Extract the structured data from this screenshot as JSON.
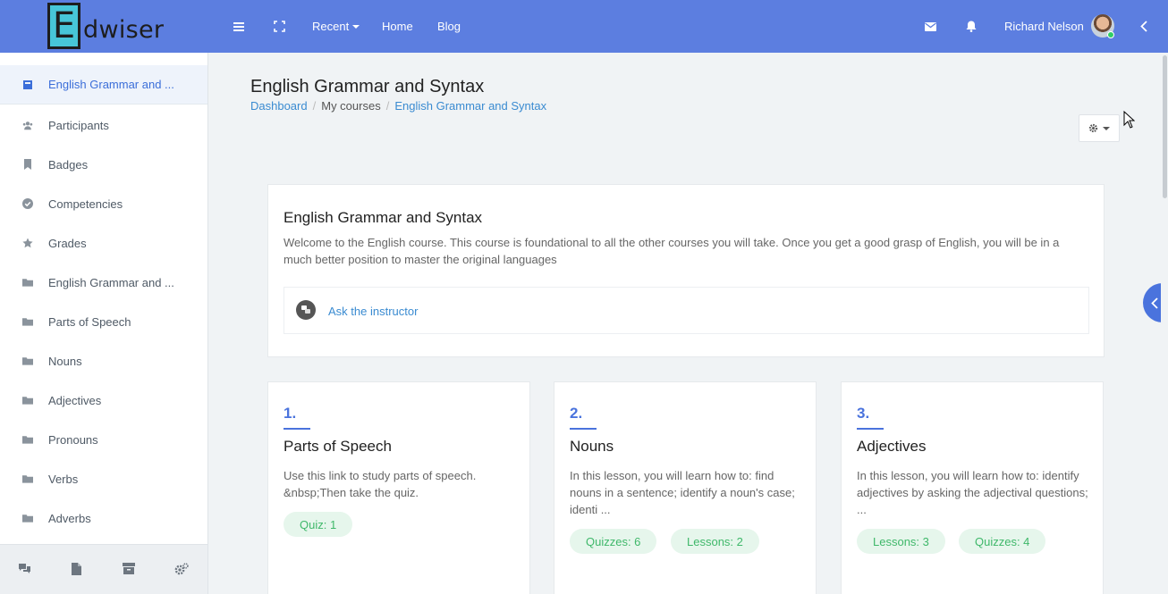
{
  "brand": {
    "letter": "E",
    "rest": "dwiser"
  },
  "navbar": {
    "recent_label": "Recent",
    "home_label": "Home",
    "blog_label": "Blog",
    "user_name": "Richard Nelson"
  },
  "sidebar": {
    "items": [
      {
        "label": "English Grammar and ...",
        "icon": "course-icon"
      },
      {
        "label": "Participants",
        "icon": "users-icon"
      },
      {
        "label": "Badges",
        "icon": "bookmark-icon"
      },
      {
        "label": "Competencies",
        "icon": "check-circle-icon"
      },
      {
        "label": "Grades",
        "icon": "star-icon"
      },
      {
        "label": "English Grammar and ...",
        "icon": "folder-icon"
      },
      {
        "label": "Parts of Speech",
        "icon": "folder-icon"
      },
      {
        "label": "Nouns",
        "icon": "folder-icon"
      },
      {
        "label": "Adjectives",
        "icon": "folder-icon"
      },
      {
        "label": "Pronouns",
        "icon": "folder-icon"
      },
      {
        "label": "Verbs",
        "icon": "folder-icon"
      },
      {
        "label": "Adverbs",
        "icon": "folder-icon"
      }
    ]
  },
  "page": {
    "title": "English Grammar and Syntax",
    "breadcrumb": [
      "Dashboard",
      "My courses",
      "English Grammar and Syntax"
    ]
  },
  "summary": {
    "title": "English Grammar and Syntax",
    "description": "Welcome to the English course.  This course is foundational to all the other courses you will take.  Once you get a good grasp of English, you will be in a much better position to master the original languages",
    "ask_label": "Ask the instructor"
  },
  "lessons": [
    {
      "num": "1.",
      "title": "Parts of Speech",
      "desc": "Use this link to study parts of speech. &nbsp;Then take the quiz.",
      "pills": [
        "Quiz: 1"
      ]
    },
    {
      "num": "2.",
      "title": "Nouns",
      "desc": "In this lesson, you will learn how to: find nouns in a sentence; identify a noun's case; identi ...",
      "pills": [
        "Quizzes: 6",
        "Lessons: 2"
      ]
    },
    {
      "num": "3.",
      "title": "Adjectives",
      "desc": "In this lesson, you will learn how to: identify adjectives by asking the adjectival questions; ...",
      "pills": [
        "Lessons: 3",
        "Quizzes: 4"
      ]
    }
  ],
  "colors": {
    "navbar": "#5c7ee0",
    "accent": "#4a73dd",
    "link": "#3a8bd1",
    "pill_bg": "#e6f6ec",
    "pill_text": "#3fb86a"
  }
}
